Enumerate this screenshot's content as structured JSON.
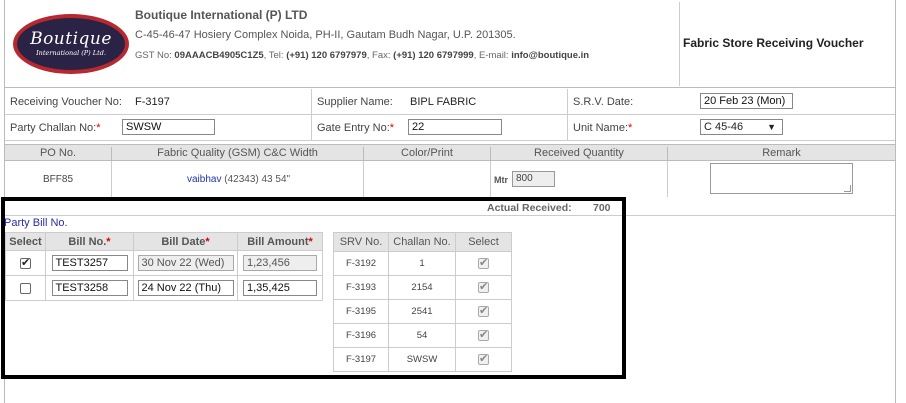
{
  "company": {
    "logo_name": "Boutique",
    "logo_sub": "International (P) Ltd.",
    "name": "Boutique International (P) LTD",
    "address": "C-45-46-47 Hosiery Complex Noida, PH-II, Gautam Budh Nagar, U.P. 201305.",
    "gst_label": "GST No: ",
    "gst_no": "09AAACB4905C1Z5",
    "tel_label": ", Tel: ",
    "tel": "(+91) 120 6797979",
    "fax_label": ", Fax: ",
    "fax": "(+91) 120 6797999",
    "email_label": ", E-mail: ",
    "email": "info@boutique.in"
  },
  "voucher_title": "Fabric Store Receiving Voucher",
  "info": {
    "rv_label": "Receiving Voucher No:",
    "rv_value": "F-3197",
    "supplier_label": "Supplier Name:",
    "supplier_value": "BIPL FABRIC",
    "srv_date_label": "S.R.V. Date:",
    "srv_date_value": "20 Feb 23 (Mon)",
    "party_challan_label": "Party Challan No:",
    "party_challan_value": "SWSW",
    "gate_entry_label": "Gate Entry No:",
    "gate_entry_value": "22",
    "unit_label": "Unit Name:",
    "unit_value": "C 45-46",
    "required_mark": "*"
  },
  "fabric_grid": {
    "headers": [
      "PO No.",
      "Fabric Quality (GSM) C&C Width",
      "Color/Print",
      "Received Quantity",
      "Remark"
    ],
    "row": {
      "po": "BFF85",
      "quality_link": "vaibhav",
      "quality_rest": " (42343) 43 54\"",
      "color": "",
      "qty_unit": "Mtr",
      "qty": "800",
      "remark": ""
    }
  },
  "actual_received_label": "Actual Received:",
  "actual_received_value": "700",
  "party_bill_title": "Party Bill No.",
  "bill_table": {
    "headers": [
      "Select",
      "Bill No.",
      "Bill Date",
      "Bill Amount"
    ],
    "required_mark": "*",
    "rows": [
      {
        "selected": true,
        "bill_no": "TEST3257",
        "bill_date": "30 Nov 22 (Wed)",
        "amount": "1,23,456"
      },
      {
        "selected": false,
        "bill_no": "TEST3258",
        "bill_date": "24 Nov 22 (Thu)",
        "amount": "1,35,425"
      }
    ]
  },
  "srv_table": {
    "headers": [
      "SRV No.",
      "Challan No.",
      "Select"
    ],
    "rows": [
      {
        "srv": "F-3192",
        "challan": "1",
        "selected": true
      },
      {
        "srv": "F-3193",
        "challan": "2154",
        "selected": true
      },
      {
        "srv": "F-3195",
        "challan": "2541",
        "selected": true
      },
      {
        "srv": "F-3196",
        "challan": "54",
        "selected": true
      },
      {
        "srv": "F-3197",
        "challan": "SWSW",
        "selected": true
      }
    ]
  }
}
